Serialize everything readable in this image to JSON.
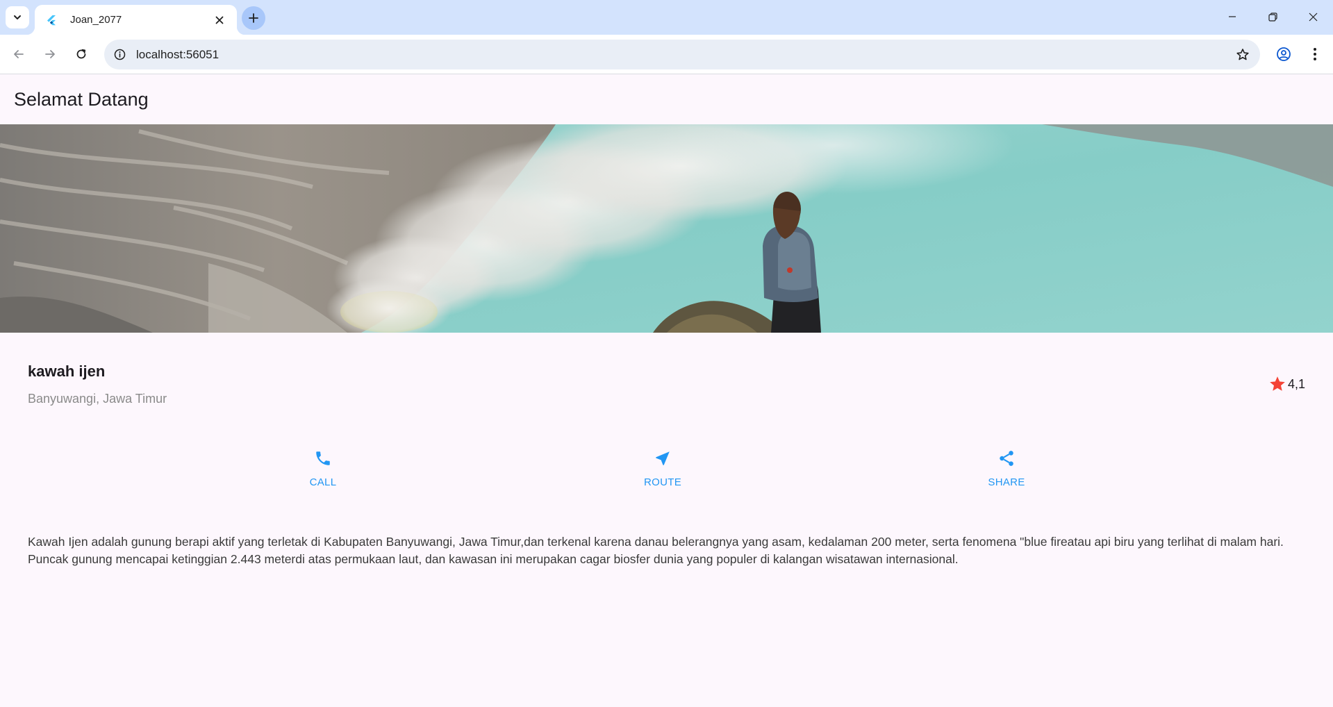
{
  "browser": {
    "tab_title": "Joan_2077",
    "url": "localhost:56051"
  },
  "app": {
    "appbar_title": "Selamat Datang",
    "place": {
      "name": "kawah ijen",
      "location": "Banyuwangi, Jawa Timur",
      "rating": "4,1",
      "rating_color": "#f44336"
    },
    "actions": [
      {
        "label": "CALL",
        "icon": "phone-icon"
      },
      {
        "label": "ROUTE",
        "icon": "navigation-icon"
      },
      {
        "label": "SHARE",
        "icon": "share-icon"
      }
    ],
    "accent_color": "#2196f3",
    "description": "Kawah Ijen adalah gunung berapi aktif yang terletak di Kabupaten Banyuwangi, Jawa Timur,dan terkenal karena danau belerangnya yang asam, kedalaman 200 meter, serta fenomena \"blue fireatau api biru yang terlihat di malam hari. Puncak gunung mencapai ketinggian 2.443 meterdi atas permukaan laut, dan kawasan ini merupakan cagar biosfer dunia yang populer di kalangan wisatawan internasional."
  }
}
